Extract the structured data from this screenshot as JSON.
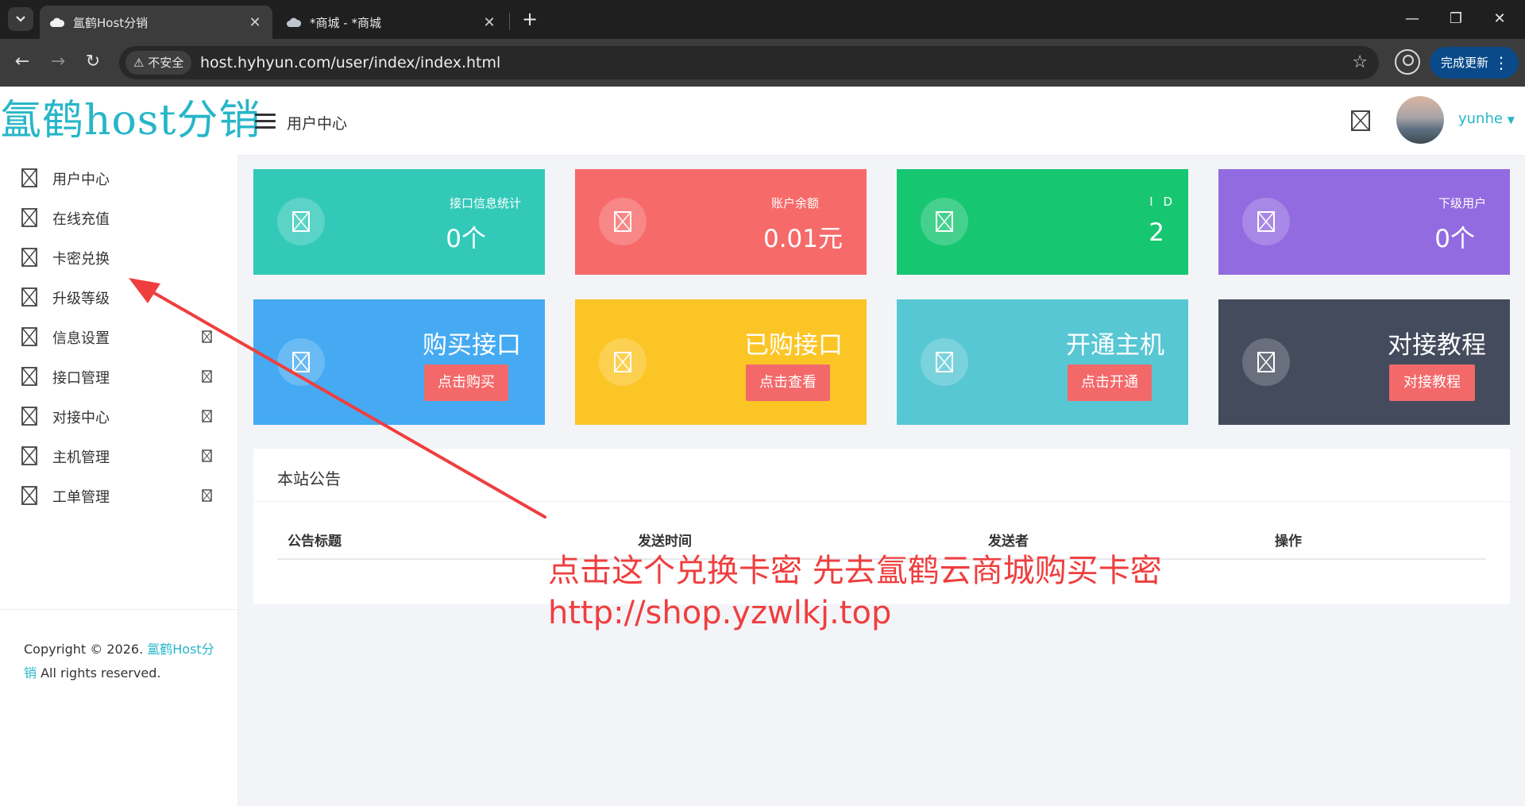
{
  "browser": {
    "tabs": [
      {
        "title": "氲鹤Host分销",
        "active": true
      },
      {
        "title": "*商城 - *商城",
        "active": false
      }
    ],
    "url": "host.hyhyun.com/user/index/index.html",
    "security_label": "不安全",
    "update_button": "完成更新"
  },
  "header": {
    "logo_text": "氲鹤host分销",
    "title": "用户中心",
    "username": "yunhe"
  },
  "sidebar": {
    "items": [
      {
        "label": "用户中心",
        "has_arrow": false
      },
      {
        "label": "在线充值",
        "has_arrow": false
      },
      {
        "label": "卡密兑换",
        "has_arrow": false
      },
      {
        "label": "升级等级",
        "has_arrow": false
      },
      {
        "label": "信息设置",
        "has_arrow": true
      },
      {
        "label": "接口管理",
        "has_arrow": true
      },
      {
        "label": "对接中心",
        "has_arrow": true
      },
      {
        "label": "主机管理",
        "has_arrow": true
      },
      {
        "label": "工单管理",
        "has_arrow": true
      }
    ],
    "copyright_prefix": "Copyright © 2026.",
    "copyright_brand": "氲鹤Host分销",
    "copyright_suffix": "All rights reserved."
  },
  "stats": [
    {
      "label": "接口信息统计",
      "value": "0个",
      "color": "#32c9b8"
    },
    {
      "label": "账户余额",
      "value": "0.01元",
      "color": "#f76a6a"
    },
    {
      "label": "I D",
      "value": "2",
      "color": "#17c671"
    },
    {
      "label": "下级用户",
      "value": "0个",
      "color": "#936be0"
    }
  ],
  "actions": [
    {
      "title": "购买接口",
      "button": "点击购买",
      "color": "#45aaf2"
    },
    {
      "title": "已购接口",
      "button": "点击查看",
      "color": "#fcc526"
    },
    {
      "title": "开通主机",
      "button": "点击开通",
      "color": "#58c7d4"
    },
    {
      "title": "对接教程",
      "button": "对接教程",
      "color": "#444b5c"
    }
  ],
  "announcements": {
    "title": "本站公告",
    "columns": [
      "公告标题",
      "发送时间",
      "发送者",
      "操作"
    ],
    "rows": []
  },
  "annotation": {
    "line1": "点击这个兑换卡密 先去氲鹤云商城购买卡密",
    "line2": "http://shop.yzwlkj.top",
    "color": "#ef3e3e"
  }
}
